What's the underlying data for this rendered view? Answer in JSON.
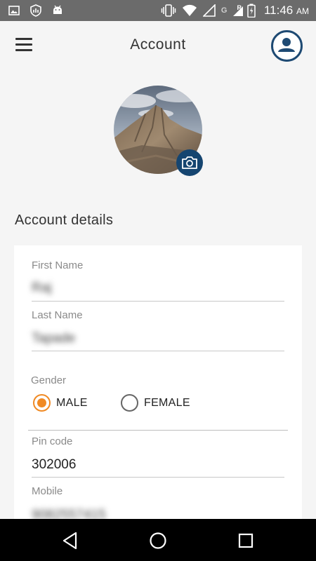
{
  "status_bar": {
    "time": "11:46",
    "ampm": "AM",
    "network_letters": [
      "G",
      "R"
    ]
  },
  "app_bar": {
    "title": "Account"
  },
  "section": {
    "title": "Account details"
  },
  "form": {
    "first_name": {
      "label": "First Name",
      "value": "Raj"
    },
    "last_name": {
      "label": "Last Name",
      "value": "Tapade"
    },
    "gender": {
      "label": "Gender",
      "options": [
        "MALE",
        "FEMALE"
      ],
      "selected": "MALE"
    },
    "pin_code": {
      "label": "Pin code",
      "value": "302006"
    },
    "mobile": {
      "label": "Mobile",
      "value": "9082557415"
    }
  },
  "colors": {
    "accent": "#f08a24",
    "primary": "#154570",
    "status_bar": "#6b6b6b"
  },
  "icons": [
    "image-icon",
    "shield-icon",
    "android-icon",
    "vibrate-icon",
    "wifi-icon",
    "signal-icon",
    "battery-icon",
    "menu-icon",
    "profile-icon",
    "camera-icon",
    "back-icon",
    "home-icon",
    "recents-icon"
  ]
}
